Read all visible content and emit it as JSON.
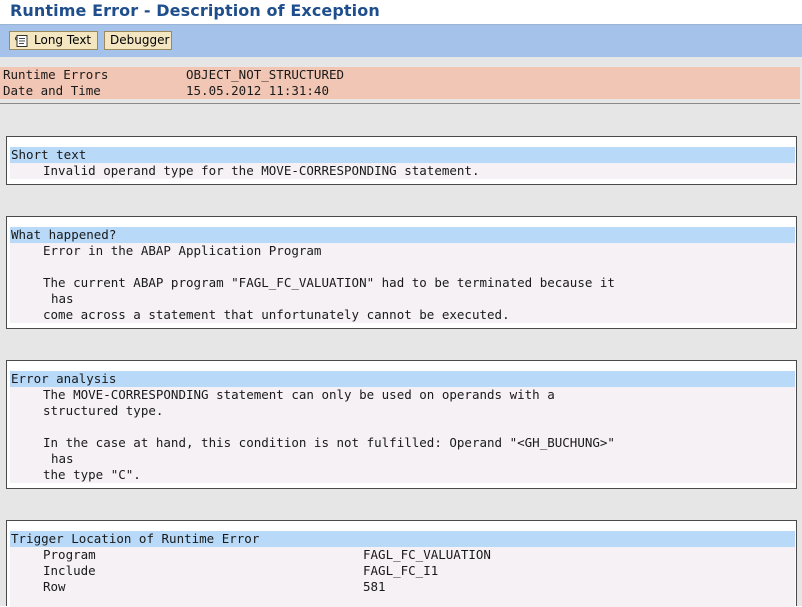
{
  "window": {
    "title": "Runtime Error - Description of Exception"
  },
  "toolbar": {
    "long_text_label": "Long Text",
    "debugger_label": "Debugger"
  },
  "header": {
    "runtime_errors_label": "Runtime Errors",
    "runtime_errors_value": "OBJECT_NOT_STRUCTURED",
    "date_time_label": "Date and Time",
    "date_time_value": "15.05.2012 11:31:40"
  },
  "short_text": {
    "heading": "Short text",
    "line1": "Invalid operand type for the MOVE-CORRESPONDING statement."
  },
  "what_happened": {
    "heading": "What happened?",
    "line1": "Error in the ABAP Application Program",
    "line2": "The current ABAP program \"FAGL_FC_VALUATION\" had to be terminated because it",
    "line3": "has",
    "line4": "come across a statement that unfortunately cannot be executed."
  },
  "error_analysis": {
    "heading": "Error analysis",
    "line1": "The MOVE-CORRESPONDING statement can only be used on operands with a",
    "line2": "structured type.",
    "line3": "In the case at hand, this condition is not fulfilled: Operand \"<GH_BUCHUNG>\"",
    "line4": "has",
    "line5": "the type \"C\"."
  },
  "trigger_location": {
    "heading": "Trigger Location of Runtime Error",
    "program_label": "Program",
    "program_value": "FAGL_FC_VALUATION",
    "include_label": "Include",
    "include_value": "FAGL_FC_I1",
    "row_label": "Row",
    "row_value": "581"
  }
}
